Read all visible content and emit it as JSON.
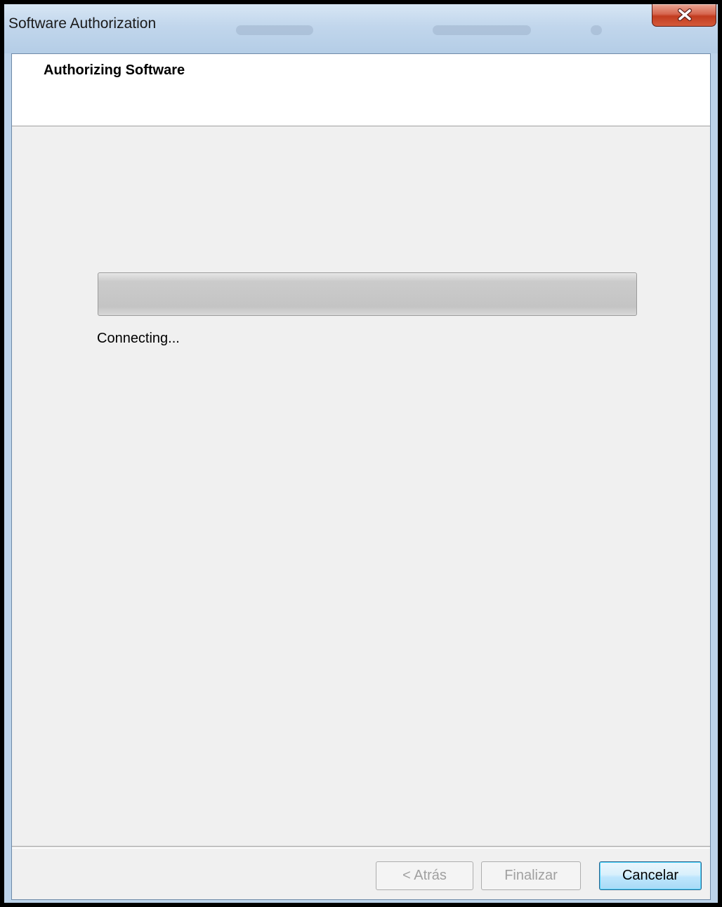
{
  "window": {
    "title": "Software Authorization"
  },
  "header": {
    "title": "Authorizing Software"
  },
  "progress": {
    "value_fraction": 0.0,
    "status_text": "Connecting..."
  },
  "buttons": {
    "back_label": "< Atrás",
    "finish_label": "Finalizar",
    "cancel_label": "Cancelar"
  },
  "icons": {
    "close": "close-icon"
  },
  "colors": {
    "accent": "#c23c1f",
    "client_bg": "#f0f0f0",
    "header_bg": "#ffffff"
  }
}
